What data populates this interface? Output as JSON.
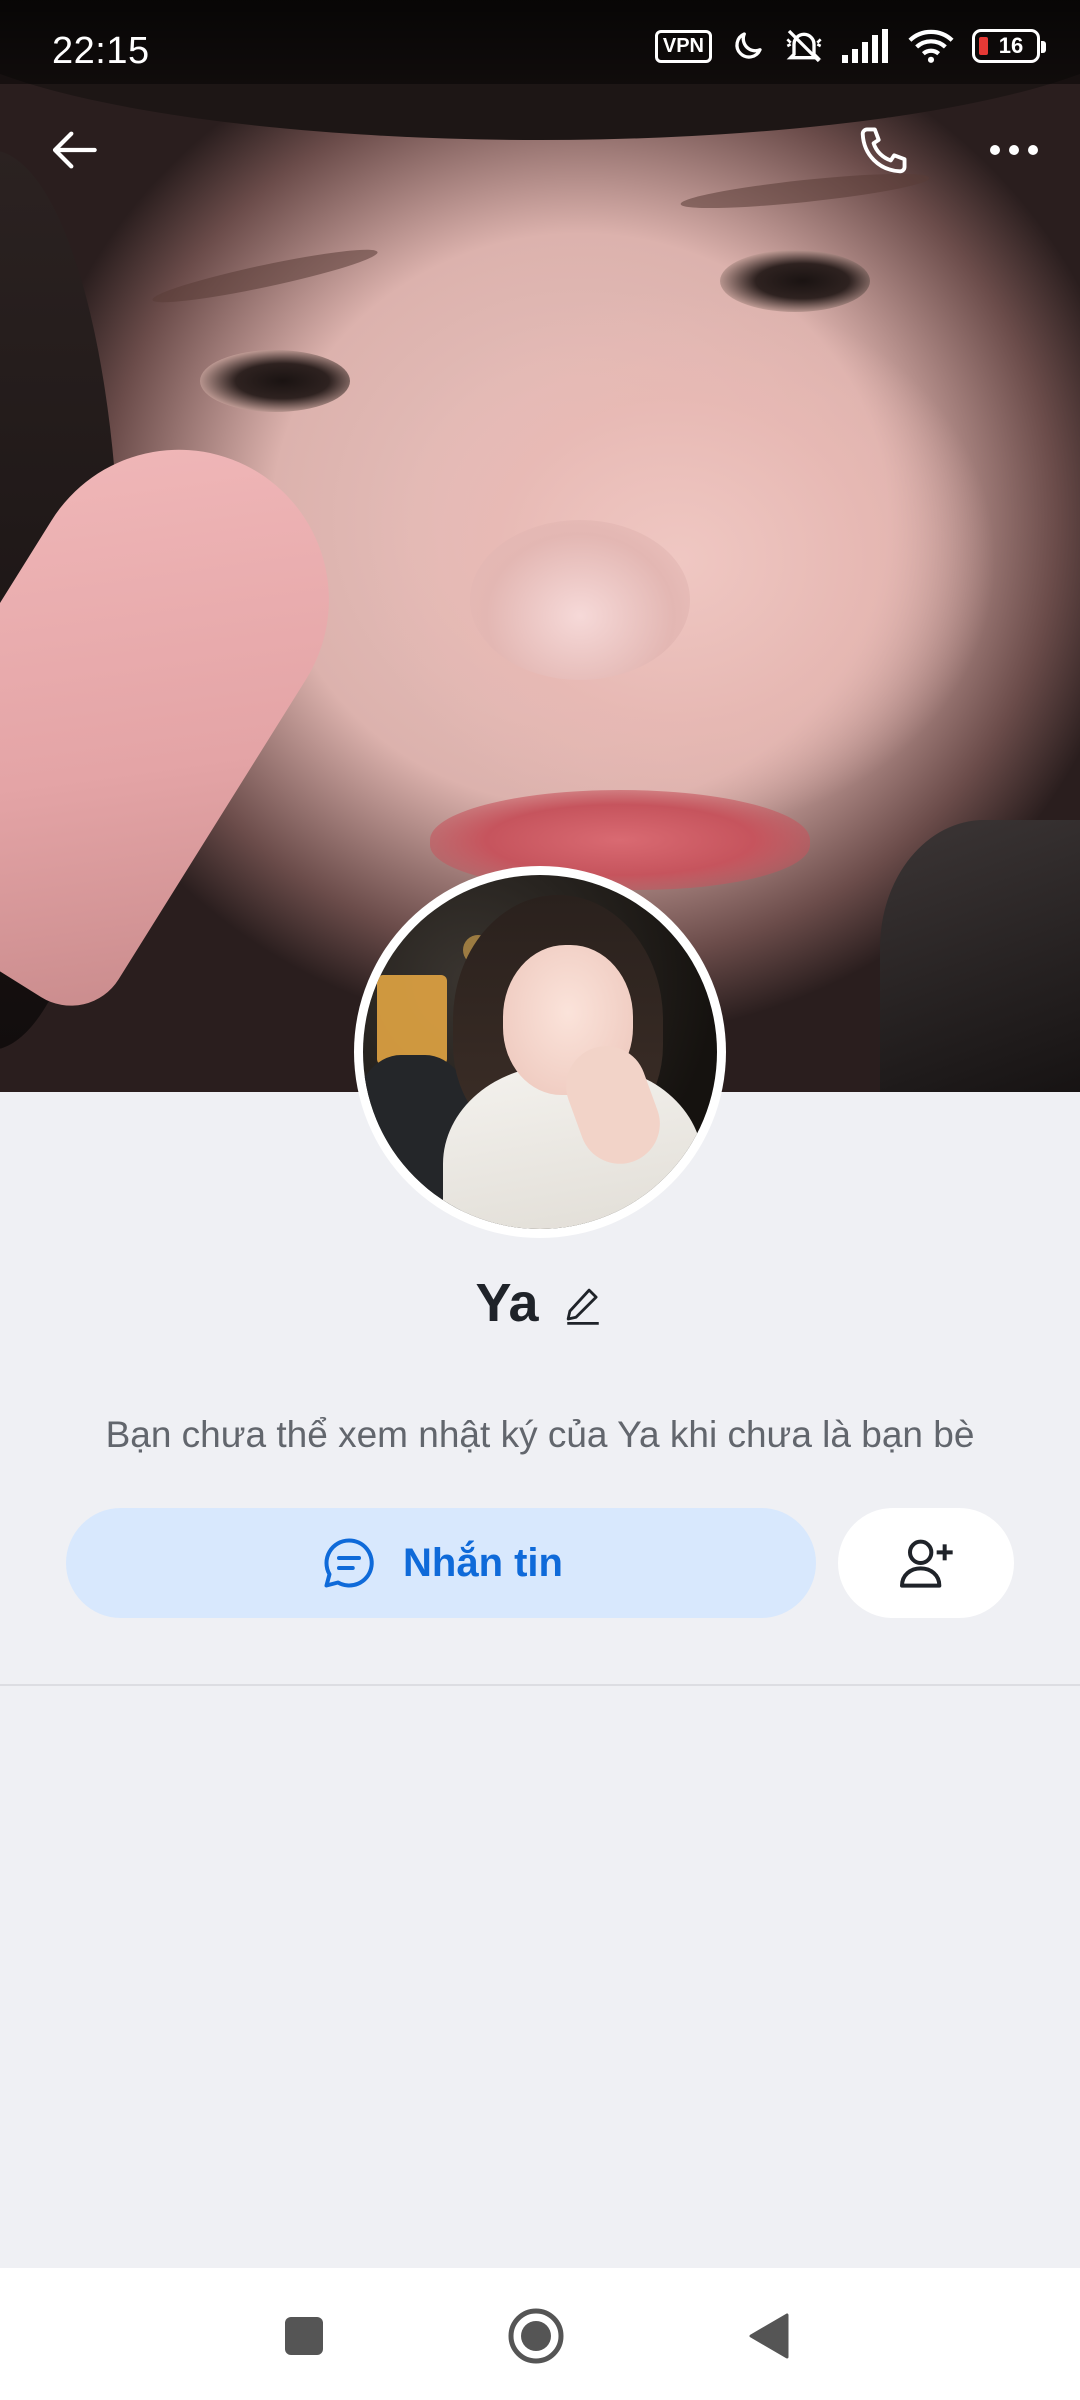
{
  "status_bar": {
    "time": "22:15",
    "vpn_label": "VPN",
    "battery_level": "16",
    "icons": [
      "vpn-icon",
      "moon-icon",
      "silent-icon",
      "signal-icon",
      "wifi-icon",
      "battery-icon"
    ]
  },
  "top_bar": {
    "icons": [
      "back-arrow-icon",
      "phone-icon",
      "more-icon"
    ]
  },
  "profile": {
    "name": "Ya",
    "privacy_note": "Bạn chưa thể xem nhật ký của Ya khi chưa là bạn bè"
  },
  "actions": {
    "message_label": "Nhắn tin",
    "message_icon": "chat-bubble-icon",
    "add_friend_icon": "add-friend-icon"
  },
  "colors": {
    "accent": "#0f6ad9",
    "message_button_bg": "#d8e8fd",
    "page_bg": "#eff0f4"
  },
  "nav_bar": {
    "icons": [
      "recents-icon",
      "home-icon",
      "back-icon"
    ]
  }
}
